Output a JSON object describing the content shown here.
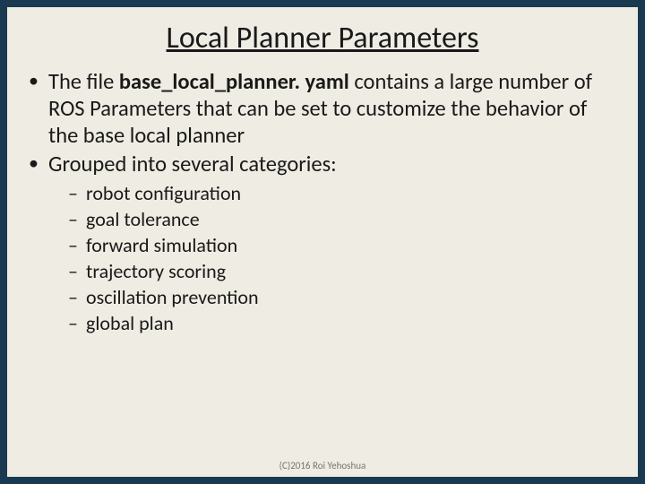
{
  "title": "Local Planner Parameters",
  "bullets": {
    "b1_pre": "The file ",
    "b1_bold": "base_local_planner. yaml",
    "b1_post": " contains a large number of ROS Parameters that can be set to customize the behavior of the base local planner",
    "b2": "Grouped into several categories:"
  },
  "categories": [
    "robot configuration",
    "goal tolerance",
    "forward simulation",
    "trajectory scoring",
    "oscillation prevention",
    "global plan"
  ],
  "footer": "(C)2016 Roi Yehoshua"
}
